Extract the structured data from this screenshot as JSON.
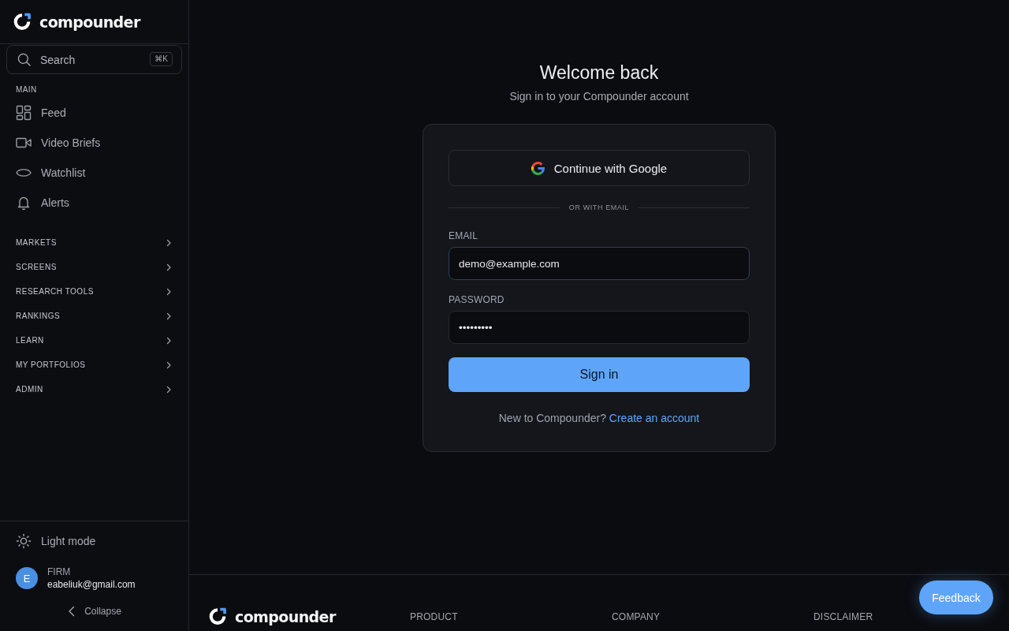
{
  "sidebar": {
    "brand": "compounder",
    "search": {
      "placeholder": "Search",
      "shortcut": "⌘K"
    },
    "main_section": {
      "heading": "MAIN",
      "items": [
        {
          "label": "Feed",
          "kind": "grid"
        },
        {
          "label": "Video Briefs",
          "kind": "video"
        },
        {
          "label": "Watchlist",
          "kind": "eye"
        },
        {
          "label": "Alerts",
          "kind": "bell"
        }
      ]
    },
    "groups": [
      {
        "label": "MARKETS",
        "expanded": false
      },
      {
        "label": "SCREENS",
        "expanded": false
      },
      {
        "label": "RESEARCH TOOLS",
        "expanded": false
      },
      {
        "label": "RANKINGS",
        "expanded": false
      },
      {
        "label": "LEARN",
        "expanded": false
      },
      {
        "label": "MY PORTFOLIOS",
        "expanded": false
      },
      {
        "label": "ADMIN",
        "expanded": false
      }
    ],
    "theme_toggle": {
      "label": "Light mode"
    },
    "user": {
      "initial": "E",
      "org": "FIRM",
      "email": "eabeliuk@gmail.com"
    },
    "collapse": {
      "label": "Collapse"
    }
  },
  "login": {
    "title": "Welcome back",
    "subtitle": "Sign in to your Compounder account",
    "google_button": "Continue with Google",
    "divider": "OR WITH EMAIL",
    "fields": [
      {
        "label": "EMAIL",
        "value": "demo@example.com",
        "focused": true
      },
      {
        "label": "PASSWORD",
        "value": "•••••••••",
        "focused": false
      }
    ],
    "submit": "Sign in",
    "signup_prompt": "New to Compounder?",
    "signup_link": "Create an account"
  },
  "footer": {
    "brand": "compounder",
    "columns": [
      "PRODUCT",
      "COMPANY",
      "DISCLAIMER"
    ]
  },
  "feedback_button": "Feedback"
}
